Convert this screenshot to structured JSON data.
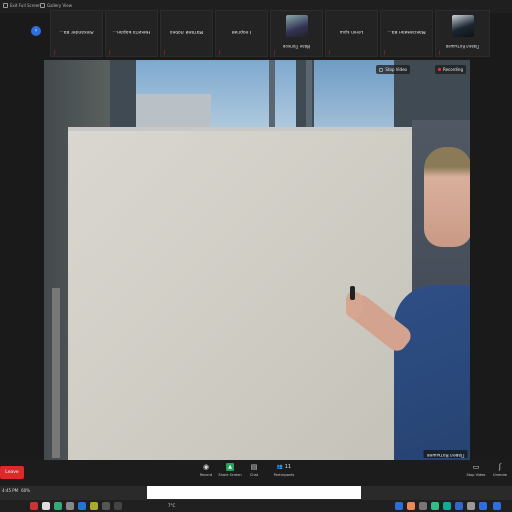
{
  "topbar": {
    "gallery_view": "Gallery View",
    "exit_full_screen": "Exit Full Screen"
  },
  "participants": [
    {
      "name": "Alexander Ba...",
      "icon": "mic-muted-icon"
    },
    {
      "name": "Никита Баран...",
      "icon": "mic-muted-icon"
    },
    {
      "name": "Матвей Лобко",
      "icon": "mic-muted-icon"
    },
    {
      "name": "Георгий",
      "icon": "mic-muted-icon"
    },
    {
      "name": "Иван Попков",
      "icon": "mic-muted-icon"
    },
    {
      "name": "Lенin Ерш",
      "icon": "mic-muted-icon"
    },
    {
      "name": "Максимиан Ва...",
      "icon": "mic-muted-icon"
    },
    {
      "name": "Павел Котышев",
      "icon": "mic-muted-icon"
    }
  ],
  "video": {
    "recording_label": "Recording",
    "stop_video_label": "Stop Video",
    "speaker_name": "Павел Котышев"
  },
  "toolbar": {
    "leave": "Leave",
    "record": "Record",
    "share_screen": "Share Screen",
    "chat": "Chat",
    "participants": "Participants",
    "participants_count": "11",
    "stop_video": "Stop Video",
    "unmute": "Unmute"
  },
  "taskbar": {
    "battery": "60%",
    "time": "4:45 PM",
    "temperature": "7°C"
  },
  "colors": {
    "leave": "#e02828",
    "accent": "#2d6fe0",
    "share": "#22a35a"
  }
}
